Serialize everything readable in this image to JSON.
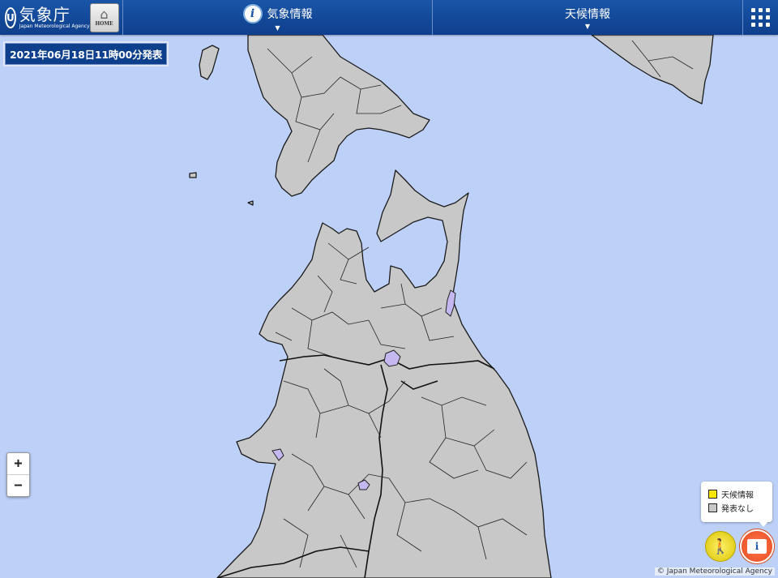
{
  "header": {
    "logo_ja": "気象庁",
    "logo_en": "Japan Meteorological Agency",
    "home_label": "HOME",
    "menu_weather": "気象情報",
    "menu_climate": "天候情報"
  },
  "timestamp": "2021年06月18日11時00分発表",
  "zoom": {
    "in": "+",
    "out": "−"
  },
  "legend": {
    "items": [
      {
        "label": "天候情報",
        "color": "#ffe800"
      },
      {
        "label": "発表なし",
        "color": "#c8c8c8"
      }
    ]
  },
  "map": {
    "sea_color": "#bdd0f8",
    "land_color": "#c8c8c8",
    "lake_color": "#c5b8f0",
    "border_color": "#1a1a1a"
  },
  "copyright": "© Japan Meteorological Agency",
  "icons": [
    "jma-logo-icon",
    "home-icon",
    "info-icon",
    "grid-menu-icon",
    "person-icon",
    "book-icon"
  ]
}
